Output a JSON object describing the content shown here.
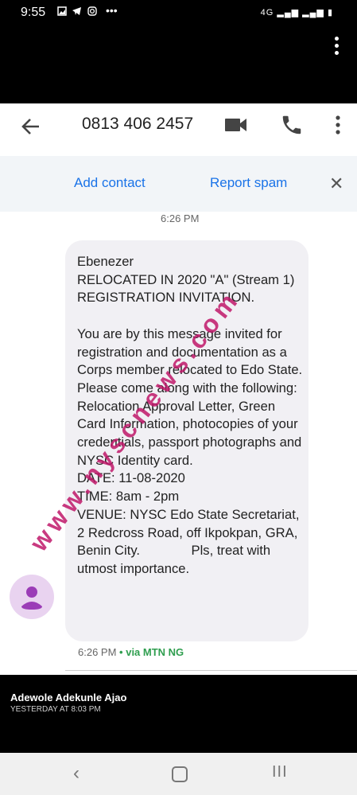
{
  "status_bar": {
    "time": "9:55",
    "right": "4G ▂▄▆ ▂▄▆ ▮"
  },
  "header": {
    "title": "0813 406 2457"
  },
  "spam_banner": {
    "add_contact": "Add contact",
    "report_spam": "Report spam",
    "close": "✕"
  },
  "conversation": {
    "time_divider": "6:26 PM",
    "message": "Ebenezer\nRELOCATED IN 2020 \"A\" (Stream 1) REGISTRATION INVITATION.\n\nYou are by this message invited for registration and documentation as a Corps member relocated to Edo State. Please come along with the following: Relocation Approval Letter, Green Card Information, photocopies of your credentials, passport photographs and NYSC Identity card.\nDATE: 11-08-2020\nTIME: 8am - 2pm\nVENUE: NYSC Edo State Secretariat, 2 Redcross Road, off Ikpokpan, GRA, Benin City.              Pls, treat with utmost importance.",
    "meta_time": "6:26 PM",
    "meta_via": "• via MTN NG",
    "watermark": "www.nyscnews.com"
  },
  "caption": {
    "author": "Adewole Adekunle Ajao",
    "posted": "YESTERDAY AT 8:03 PM"
  },
  "nav": {
    "back": "‹",
    "recent": "III"
  },
  "colors": {
    "accent": "#1a73e8",
    "carrier": "#2f9e4f",
    "watermark": "#c0186a",
    "bubble": "#f1f0f4"
  }
}
